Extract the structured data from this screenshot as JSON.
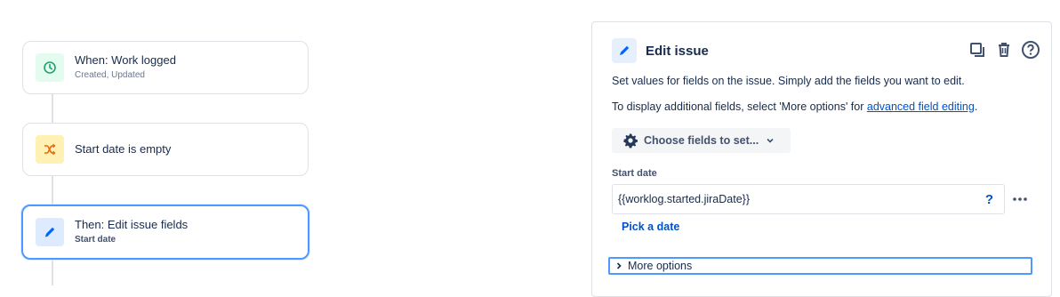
{
  "flow": {
    "trigger": {
      "title": "When: Work logged",
      "subtitle": "Created, Updated",
      "icon": "clock-icon",
      "icon_bg": "#e3fcef",
      "icon_color": "#36b37e"
    },
    "condition": {
      "title": "Start date is empty",
      "icon": "branch-icon",
      "icon_bg": "#fffae6",
      "icon_color": "#ff8b00"
    },
    "action": {
      "title": "Then: Edit issue fields",
      "subtitle": "Start date",
      "icon": "pencil-icon",
      "icon_bg": "#deebff",
      "icon_color": "#0065ff"
    }
  },
  "panel": {
    "title": "Edit issue",
    "description": "Set values for fields on the issue. Simply add the fields you want to edit.",
    "additional_prefix": "To display additional fields, select 'More options' for ",
    "additional_link": "advanced field editing",
    "additional_suffix": ".",
    "choose_button": "Choose fields to set...",
    "field_label": "Start date",
    "field_value": "{{worklog.started.jiraDate}}",
    "help_glyph": "?",
    "pick_date": "Pick a date",
    "more_options": "More options"
  }
}
